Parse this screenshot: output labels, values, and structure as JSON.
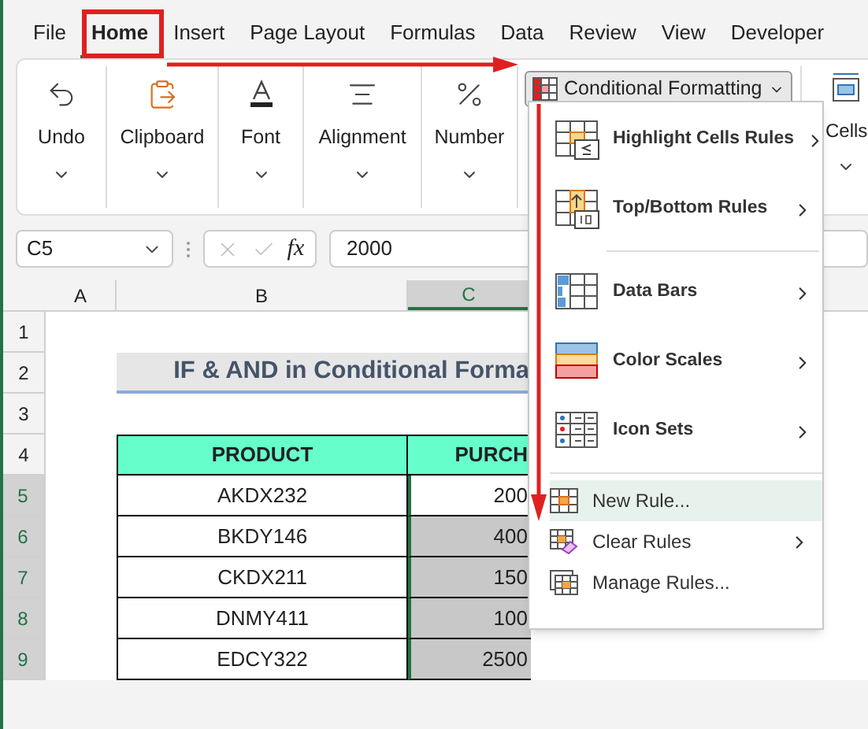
{
  "ribbon_tabs": [
    {
      "label": "File",
      "selected": false
    },
    {
      "label": "Home",
      "selected": true
    },
    {
      "label": "Insert",
      "selected": false
    },
    {
      "label": "Page Layout",
      "selected": false
    },
    {
      "label": "Formulas",
      "selected": false
    },
    {
      "label": "Data",
      "selected": false
    },
    {
      "label": "Review",
      "selected": false
    },
    {
      "label": "View",
      "selected": false
    },
    {
      "label": "Developer",
      "selected": false
    }
  ],
  "ribbon_groups": [
    {
      "label": "Undo",
      "kind": "undo"
    },
    {
      "label": "Clipboard",
      "kind": "clipboard"
    },
    {
      "label": "Font",
      "kind": "font"
    },
    {
      "label": "Alignment",
      "kind": "alignment"
    },
    {
      "label": "Number",
      "kind": "number"
    }
  ],
  "conditional_formatting": {
    "label": "Conditional Formatting"
  },
  "cells_group": {
    "label": "Cells"
  },
  "formula_bar": {
    "name_box": "C5",
    "fx": "fx",
    "value": "2000"
  },
  "sheet": {
    "columns": [
      {
        "label": "A",
        "selected": false
      },
      {
        "label": "B",
        "selected": false
      },
      {
        "label": "C",
        "selected": true
      }
    ],
    "row_numbers": [
      {
        "label": "1",
        "selected": false
      },
      {
        "label": "2",
        "selected": false
      },
      {
        "label": "3",
        "selected": false
      },
      {
        "label": "4",
        "selected": false
      },
      {
        "label": "5",
        "selected": true
      },
      {
        "label": "6",
        "selected": true
      },
      {
        "label": "7",
        "selected": true
      },
      {
        "label": "8",
        "selected": true
      },
      {
        "label": "9",
        "selected": true
      }
    ],
    "title": "IF & AND in Conditional Forma",
    "headers": [
      "PRODUCT",
      "PURCH"
    ],
    "rows": [
      {
        "product": "AKDX232",
        "purchase": "200",
        "shaded": false
      },
      {
        "product": "BKDY146",
        "purchase": "400",
        "shaded": true
      },
      {
        "product": "CKDX211",
        "purchase": "150",
        "shaded": true
      },
      {
        "product": "DNMY411",
        "purchase": "100",
        "shaded": true
      },
      {
        "product": "EDCY322",
        "purchase": "2500",
        "shaded": true
      }
    ]
  },
  "menu": {
    "items": [
      {
        "label": "Highlight Cells Rules",
        "kind": "large",
        "submenu": true,
        "highlighted": false
      },
      {
        "label": "Top/Bottom Rules",
        "kind": "large",
        "submenu": true,
        "highlighted": false
      },
      {
        "label": "Data Bars",
        "kind": "large",
        "submenu": true,
        "highlighted": false
      },
      {
        "label": "Color Scales",
        "kind": "large",
        "submenu": true,
        "highlighted": false
      },
      {
        "label": "Icon Sets",
        "kind": "large",
        "submenu": true,
        "highlighted": false
      },
      {
        "label": "New Rule...",
        "kind": "small",
        "submenu": false,
        "highlighted": true
      },
      {
        "label": "Clear Rules",
        "kind": "small",
        "submenu": true,
        "highlighted": false
      },
      {
        "label": "Manage Rules...",
        "kind": "small",
        "submenu": false,
        "highlighted": false
      }
    ]
  }
}
